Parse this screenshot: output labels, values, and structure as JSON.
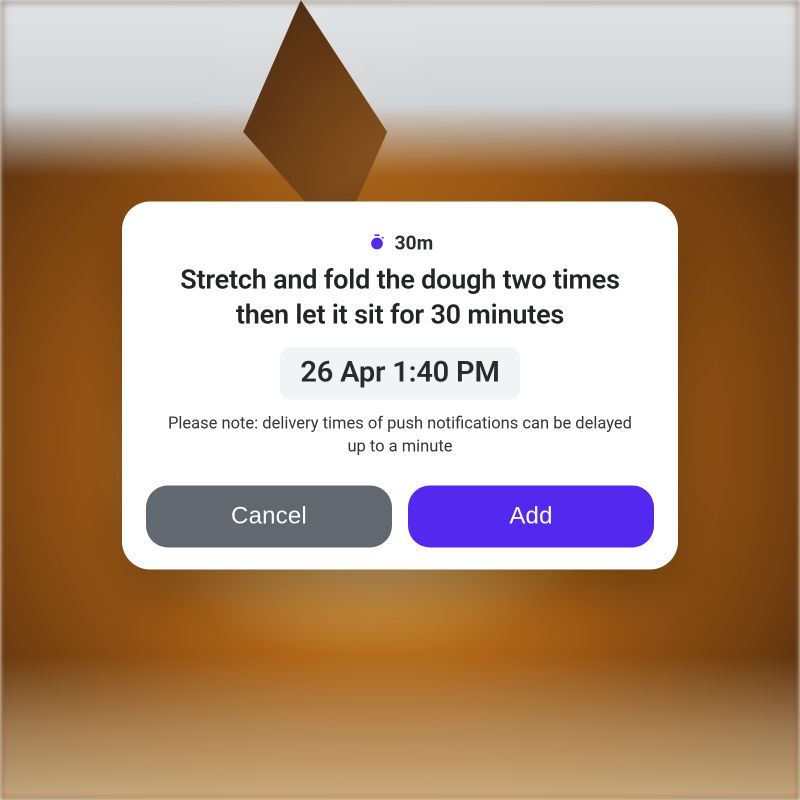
{
  "colors": {
    "accent": "#5429ef",
    "cancel_btn": "#616870",
    "chip_bg": "#f2f3f5"
  },
  "dialog": {
    "duration": "30m",
    "title": "Stretch and fold the dough two times then let it sit for 30 minutes",
    "scheduled_time": "26 Apr 1:40 PM",
    "note": "Please note: delivery times of push notifications can be delayed up to a minute",
    "buttons": {
      "cancel": "Cancel",
      "add": "Add"
    }
  }
}
